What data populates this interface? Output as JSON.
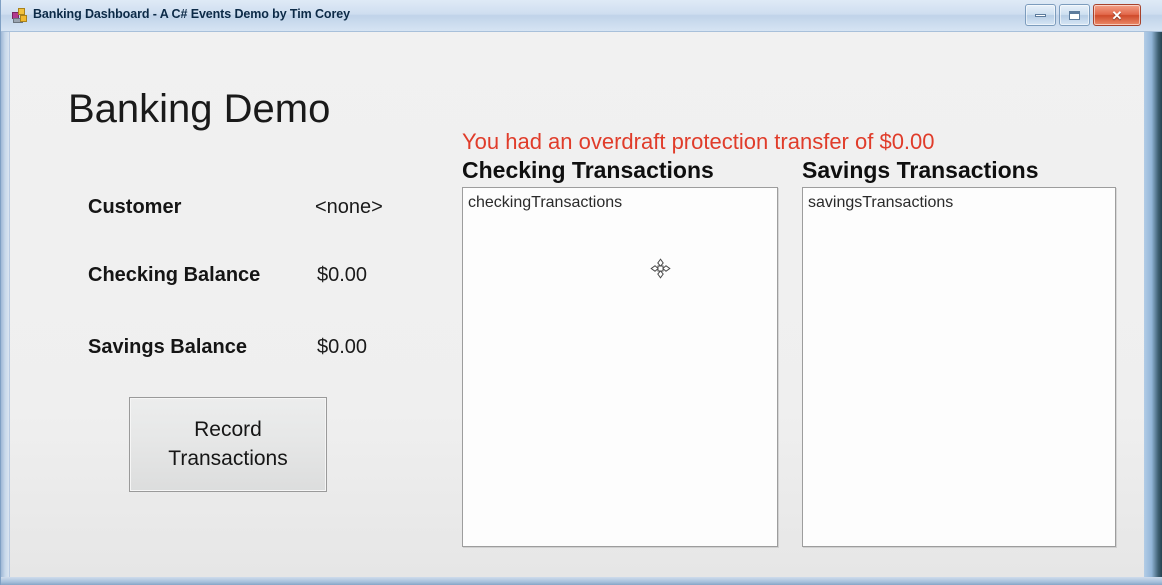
{
  "window": {
    "title": "Banking Dashboard - A C# Events Demo by Tim Corey",
    "app_icon": "winforms-app-icon",
    "controls": {
      "minimize_label": "Minimize",
      "maximize_label": "Maximize",
      "close_label": "✕"
    }
  },
  "left_panel": {
    "app_title": "Banking Demo",
    "fields": [
      {
        "label": "Customer",
        "value": "<none>"
      },
      {
        "label": "Checking Balance",
        "value": "$0.00"
      },
      {
        "label": "Savings Balance",
        "value": "$0.00"
      }
    ],
    "record_button": {
      "line1": "Record",
      "line2": "Transactions"
    }
  },
  "right_panel": {
    "alert": {
      "text": "You had an overdraft protection transfer of $0.00",
      "color": "#e03c2a"
    },
    "lists": [
      {
        "header": "Checking Transactions",
        "placeholder": "checkingTransactions",
        "items": []
      },
      {
        "header": "Savings Transactions",
        "placeholder": "savingsTransactions",
        "items": []
      }
    ]
  },
  "cursor": {
    "type": "move-cursor"
  }
}
